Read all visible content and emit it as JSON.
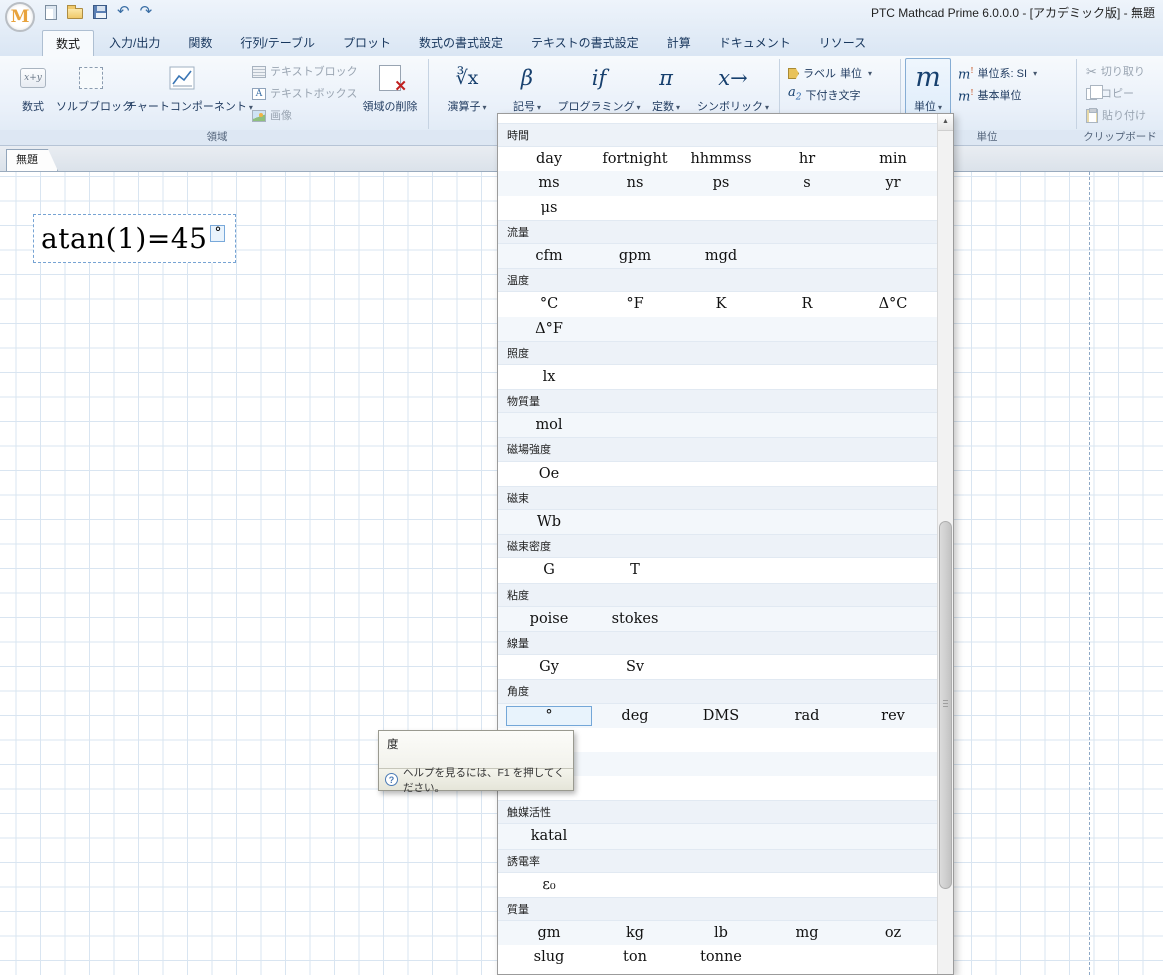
{
  "titlebar": {
    "title": "PTC Mathcad Prime 6.0.0.0 - [アカデミック版] - 無題"
  },
  "icons": {
    "logo": "M",
    "dropdown_arrow": "▾",
    "undo": "↶",
    "redo": "↷",
    "scroll_up": "▲",
    "help": "?",
    "math_glyph": "x+y",
    "operators_glyph": "∛x",
    "symbols_glyph": "β",
    "programming_glyph": "if",
    "constants_glyph": "π",
    "symbolics_glyph": "x→",
    "units_glyph": "m",
    "unit_system_glyph": "m",
    "subscript_glyph": "a",
    "subscript_sub": "2",
    "textbox_glyph": "A",
    "cut_glyph": "✂",
    "delete_glyph": "✕"
  },
  "ribbon": {
    "tabs": [
      "数式",
      "入力/出力",
      "関数",
      "行列/テーブル",
      "プロット",
      "数式の書式設定",
      "テキストの書式設定",
      "計算",
      "ドキュメント",
      "リソース"
    ],
    "active_tab": "数式",
    "regions": {
      "math": "数式",
      "solve_block": "ソルブブロック",
      "chart": "チャートコンポーネント",
      "text_block": "テキストブロック",
      "text_box": "テキストボックス",
      "image": "画像",
      "delete_region": "領域の削除",
      "group_label": "領域"
    },
    "math_group": {
      "operators": "演算子",
      "symbols": "記号",
      "programming": "プログラミング",
      "constants": "定数",
      "symbolics": "シンボリック"
    },
    "style_group": {
      "labels": "ラベル",
      "labels_value": "単位",
      "subscript": "下付き文字"
    },
    "units_group": {
      "units": "単位",
      "unit_system": "単位系: SI",
      "base_units": "基本単位",
      "group_label": "単位"
    },
    "clipboard_group": {
      "cut": "切り取り",
      "copy": "コピー",
      "paste": "貼り付け",
      "group_label": "クリップボード"
    }
  },
  "document": {
    "tab": "無題",
    "equation": "atan(1)=45",
    "equation_unit": "°"
  },
  "units_panel": {
    "rows": [
      {
        "type": "category",
        "label": "時間"
      },
      {
        "type": "units",
        "cells": [
          "day",
          "fortnight",
          "hhmmss",
          "hr",
          "min"
        ]
      },
      {
        "type": "units",
        "cells": [
          "ms",
          "ns",
          "ps",
          "s",
          "yr"
        ]
      },
      {
        "type": "units",
        "cells": [
          "μs"
        ]
      },
      {
        "type": "category",
        "label": "流量"
      },
      {
        "type": "units",
        "cells": [
          "cfm",
          "gpm",
          "mgd"
        ]
      },
      {
        "type": "category",
        "label": "温度"
      },
      {
        "type": "units",
        "cells": [
          "°C",
          "°F",
          "K",
          "R",
          "Δ°C"
        ]
      },
      {
        "type": "units",
        "cells": [
          "Δ°F"
        ]
      },
      {
        "type": "category",
        "label": "照度"
      },
      {
        "type": "units",
        "cells": [
          "lx"
        ]
      },
      {
        "type": "category",
        "label": "物質量"
      },
      {
        "type": "units",
        "cells": [
          "mol"
        ]
      },
      {
        "type": "category",
        "label": "磁場強度"
      },
      {
        "type": "units",
        "cells": [
          "Oe"
        ]
      },
      {
        "type": "category",
        "label": "磁束"
      },
      {
        "type": "units",
        "cells": [
          "Wb"
        ]
      },
      {
        "type": "category",
        "label": "磁束密度"
      },
      {
        "type": "units",
        "cells": [
          "G",
          "T"
        ]
      },
      {
        "type": "category",
        "label": "粘度"
      },
      {
        "type": "units",
        "cells": [
          "poise",
          "stokes"
        ]
      },
      {
        "type": "category",
        "label": "線量"
      },
      {
        "type": "units",
        "cells": [
          "Gy",
          "Sv"
        ]
      },
      {
        "type": "category",
        "label": "角度"
      },
      {
        "type": "units",
        "cells": [
          "°",
          "deg",
          "DMS",
          "rad",
          "rev"
        ],
        "selected": 0
      },
      {
        "type": "units",
        "cells": []
      },
      {
        "type": "units",
        "cells": []
      },
      {
        "type": "units",
        "cells": []
      },
      {
        "type": "category",
        "label": "触媒活性"
      },
      {
        "type": "units",
        "cells": [
          "katal"
        ]
      },
      {
        "type": "category",
        "label": "誘電率"
      },
      {
        "type": "units",
        "cells": [
          "ε₀"
        ]
      },
      {
        "type": "category",
        "label": "質量"
      },
      {
        "type": "units",
        "cells": [
          "gm",
          "kg",
          "lb",
          "mg",
          "oz"
        ]
      },
      {
        "type": "units",
        "cells": [
          "slug",
          "ton",
          "tonne"
        ]
      }
    ]
  },
  "tooltip": {
    "title": "度",
    "help_text": "ヘルプを見るには、F1 を押してください。"
  }
}
